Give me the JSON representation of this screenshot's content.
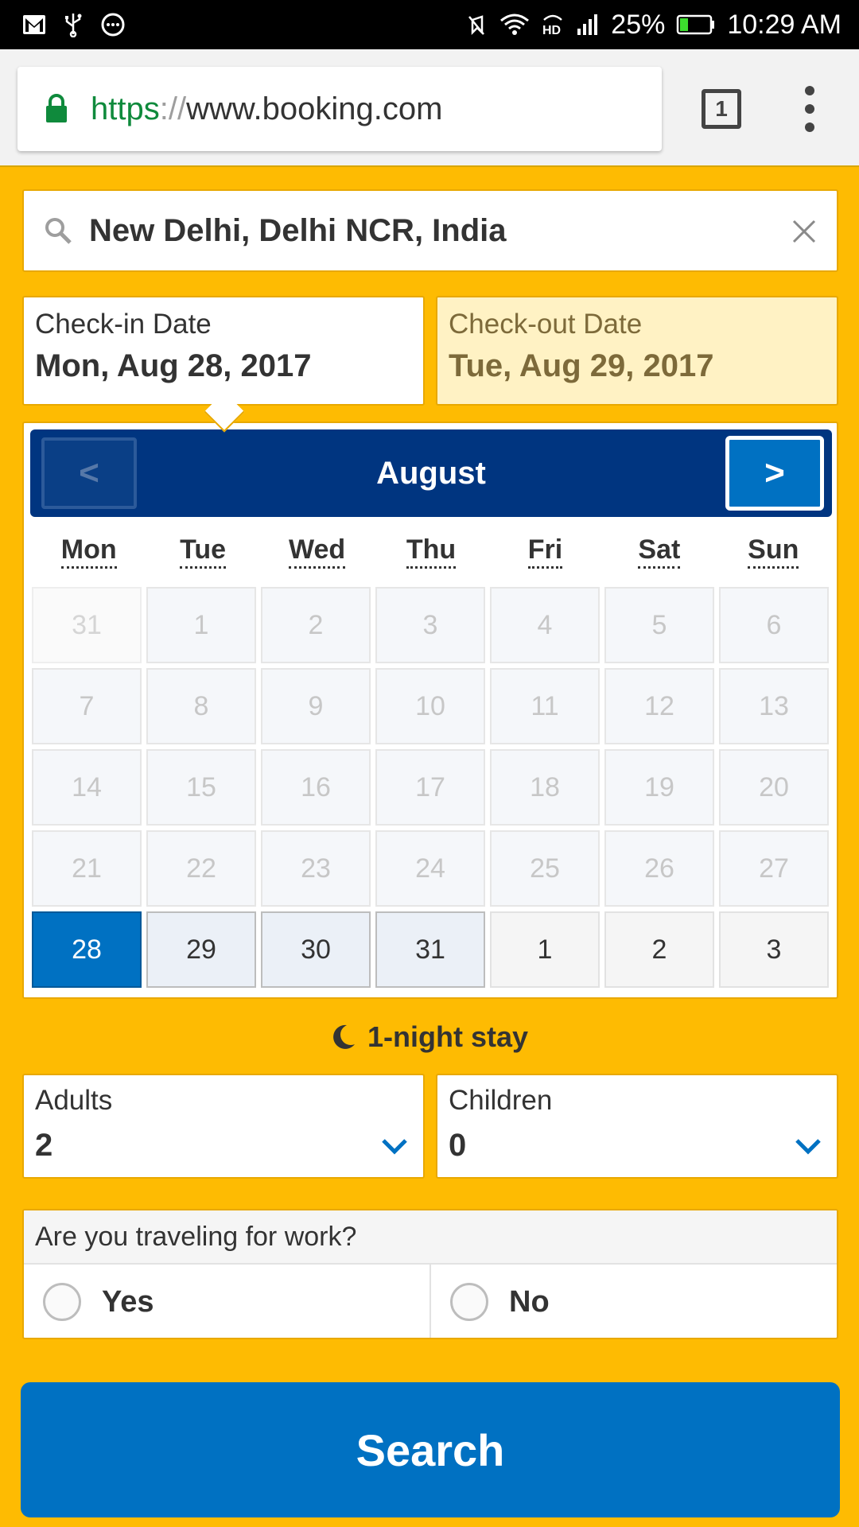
{
  "status_bar": {
    "battery": "25%",
    "time": "10:29 AM",
    "icons_left": [
      "gmail-icon",
      "usb-icon",
      "messaging-icon"
    ],
    "icons_right": [
      "mute-icon",
      "wifi-icon",
      "hd-icon",
      "signal-icon",
      "battery-icon"
    ]
  },
  "browser": {
    "url_scheme": "https",
    "url_sep": "://",
    "url_host": "www.booking.com",
    "tab_count": "1"
  },
  "search": {
    "destination": "New Delhi, Delhi NCR, India"
  },
  "dates": {
    "checkin_label": "Check-in Date",
    "checkin_value": "Mon, Aug 28, 2017",
    "checkout_label": "Check-out Date",
    "checkout_value": "Tue, Aug 29, 2017"
  },
  "calendar": {
    "month": "August",
    "prev_label": "<",
    "next_label": ">",
    "weekdays": [
      "Mon",
      "Tue",
      "Wed",
      "Thu",
      "Fri",
      "Sat",
      "Sun"
    ],
    "days": [
      {
        "label": "31",
        "state": "prev-month"
      },
      {
        "label": "1",
        "state": "disabled"
      },
      {
        "label": "2",
        "state": "disabled"
      },
      {
        "label": "3",
        "state": "disabled"
      },
      {
        "label": "4",
        "state": "disabled"
      },
      {
        "label": "5",
        "state": "disabled"
      },
      {
        "label": "6",
        "state": "disabled"
      },
      {
        "label": "7",
        "state": "disabled"
      },
      {
        "label": "8",
        "state": "disabled"
      },
      {
        "label": "9",
        "state": "disabled"
      },
      {
        "label": "10",
        "state": "disabled"
      },
      {
        "label": "11",
        "state": "disabled"
      },
      {
        "label": "12",
        "state": "disabled"
      },
      {
        "label": "13",
        "state": "disabled"
      },
      {
        "label": "14",
        "state": "disabled"
      },
      {
        "label": "15",
        "state": "disabled"
      },
      {
        "label": "16",
        "state": "disabled"
      },
      {
        "label": "17",
        "state": "disabled"
      },
      {
        "label": "18",
        "state": "disabled"
      },
      {
        "label": "19",
        "state": "disabled"
      },
      {
        "label": "20",
        "state": "disabled"
      },
      {
        "label": "21",
        "state": "disabled"
      },
      {
        "label": "22",
        "state": "disabled"
      },
      {
        "label": "23",
        "state": "disabled"
      },
      {
        "label": "24",
        "state": "disabled"
      },
      {
        "label": "25",
        "state": "disabled"
      },
      {
        "label": "26",
        "state": "disabled"
      },
      {
        "label": "27",
        "state": "disabled"
      },
      {
        "label": "28",
        "state": "selected"
      },
      {
        "label": "29",
        "state": "in-range"
      },
      {
        "label": "30",
        "state": "in-range"
      },
      {
        "label": "31",
        "state": "in-range"
      },
      {
        "label": "1",
        "state": "available"
      },
      {
        "label": "2",
        "state": "available"
      },
      {
        "label": "3",
        "state": "available"
      }
    ]
  },
  "stay": {
    "nights_text": "1-night stay"
  },
  "guests": {
    "adults_label": "Adults",
    "adults_value": "2",
    "children_label": "Children",
    "children_value": "0"
  },
  "work": {
    "question": "Are you traveling for work?",
    "yes_label": "Yes",
    "no_label": "No"
  },
  "search_button": {
    "label": "Search"
  },
  "colors": {
    "brand_yellow": "#febb02",
    "brand_navy": "#003580",
    "brand_blue": "#0071c2"
  }
}
